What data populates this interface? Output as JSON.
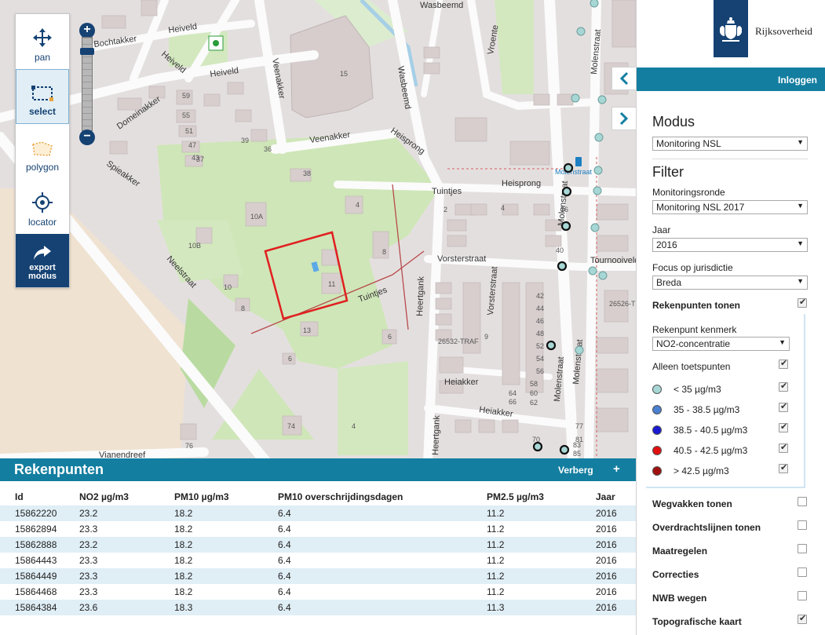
{
  "toolbar": {
    "tools": [
      {
        "label": "pan"
      },
      {
        "label": "select"
      },
      {
        "label": "polygon"
      },
      {
        "label": "locator"
      },
      {
        "label": "export modus"
      }
    ]
  },
  "zoom": {
    "in": "+",
    "out": "−"
  },
  "map": {
    "streets": [
      "Bochtakker",
      "Heiveld",
      "Heiveld",
      "Heiveld",
      "Domeinakker",
      "Spieakker",
      "Veenakker",
      "Veenakker",
      "Wasbeemd",
      "Wasbeemd",
      "Vroente",
      "Molenstraat",
      "Heisprong",
      "Heisprong",
      "Tuintjes",
      "Tuintjes",
      "Vorsterstraat",
      "Vorsterstraat",
      "Neelstraat",
      "Heertgank",
      "Heertgank",
      "Heiakker",
      "Heiakker",
      "Molenstraat",
      "Molenstraat",
      "Molenstraat",
      "Tournooiveld",
      "Vianendreef"
    ],
    "house_numbers": [
      "59",
      "55",
      "51",
      "47",
      "43",
      "39",
      "37",
      "36",
      "15",
      "38",
      "10A",
      "10B",
      "4",
      "8",
      "11",
      "10",
      "8",
      "13",
      "6",
      "6",
      "74",
      "4",
      "76",
      "2",
      "4",
      "36",
      "40",
      "42",
      "44",
      "46",
      "48",
      "52",
      "54",
      "56",
      "58",
      "60",
      "62",
      "64",
      "66",
      "70",
      "77",
      "81",
      "83",
      "85",
      "26532-TRAF",
      "26526-TRAF",
      "9"
    ],
    "station_label": "Molenstraat",
    "selection_color": "#e02020"
  },
  "side": {
    "brand": "Rijksoverheid",
    "login": "Inloggen",
    "modus_title": "Modus",
    "modus_value": "Monitoring NSL",
    "filter_title": "Filter",
    "monitoringsronde_label": "Monitoringsronde",
    "monitoringsronde_value": "Monitoring NSL 2017",
    "jaar_label": "Jaar",
    "jaar_value": "2016",
    "focus_label": "Focus op jurisdictie",
    "focus_value": "Breda",
    "rekenpunten_tonen": "Rekenpunten tonen",
    "kenmerk_label": "Rekenpunt kenmerk",
    "kenmerk_value": "NO2-concentratie",
    "alleen_toets": "Alleen toetspunten",
    "legend": [
      {
        "label": "< 35 µg/m3",
        "color": "#a7d7d5",
        "checked": true
      },
      {
        "label": "35 - 38.5 µg/m3",
        "color": "#4b7fd0",
        "checked": true
      },
      {
        "label": "38.5 - 40.5 µg/m3",
        "color": "#1a1ad0",
        "checked": true
      },
      {
        "label": "40.5 - 42.5 µg/m3",
        "color": "#e01010",
        "checked": true
      },
      {
        "label": "> 42.5 µg/m3",
        "color": "#a01010",
        "checked": true
      }
    ],
    "layers": [
      {
        "label": "Wegvakken tonen",
        "checked": false
      },
      {
        "label": "Overdrachtslijnen tonen",
        "checked": false
      },
      {
        "label": "Maatregelen",
        "checked": false
      },
      {
        "label": "Correcties",
        "checked": false
      },
      {
        "label": "NWB wegen",
        "checked": false
      },
      {
        "label": "Topografische kaart",
        "checked": true
      }
    ]
  },
  "bottom": {
    "title": "Rekenpunten",
    "hide": "Verberg",
    "plus": "+",
    "columns": [
      "Id",
      "NO2 µg/m3",
      "PM10 µg/m3",
      "PM10 overschrijdingsdagen",
      "PM2.5 µg/m3",
      "Jaar"
    ],
    "rows": [
      [
        "15862220",
        "23.2",
        "18.2",
        "6.4",
        "11.2",
        "2016"
      ],
      [
        "15862894",
        "23.3",
        "18.2",
        "6.4",
        "11.2",
        "2016"
      ],
      [
        "15862888",
        "23.2",
        "18.2",
        "6.4",
        "11.2",
        "2016"
      ],
      [
        "15864443",
        "23.3",
        "18.2",
        "6.4",
        "11.2",
        "2016"
      ],
      [
        "15864449",
        "23.3",
        "18.2",
        "6.4",
        "11.2",
        "2016"
      ],
      [
        "15864468",
        "23.3",
        "18.2",
        "6.4",
        "11.2",
        "2016"
      ],
      [
        "15864384",
        "23.6",
        "18.3",
        "6.4",
        "11.3",
        "2016"
      ]
    ]
  }
}
